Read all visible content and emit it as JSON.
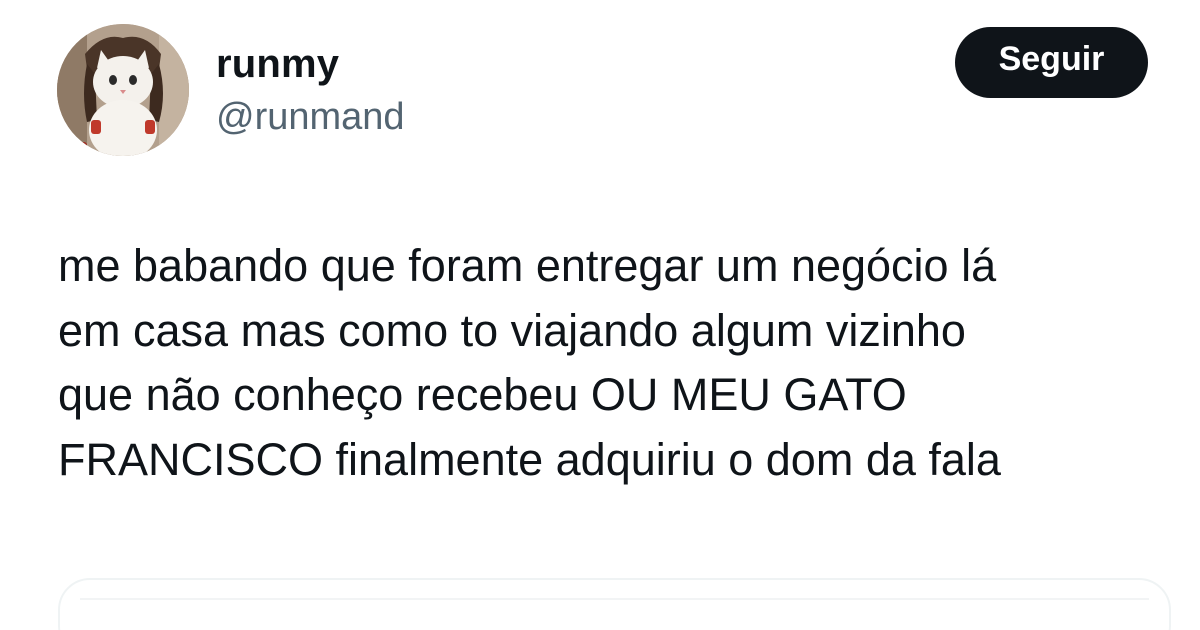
{
  "user": {
    "display_name": "runmy",
    "handle": "@runmand",
    "avatar_icon": "cat-avatar-icon"
  },
  "actions": {
    "follow_label": "Seguir"
  },
  "tweet": {
    "lines": [
      "me babando que foram entregar um negócio lá",
      "em casa mas como to viajando algum vizinho",
      "que não conheço recebeu OU MEU GATO",
      "FRANCISCO finalmente adquiriu o dom da fala"
    ]
  },
  "colors": {
    "text_primary": "#0f1419",
    "text_secondary": "#536471",
    "button_bg": "#0f1419",
    "button_text": "#ffffff",
    "border": "#eff3f4"
  }
}
